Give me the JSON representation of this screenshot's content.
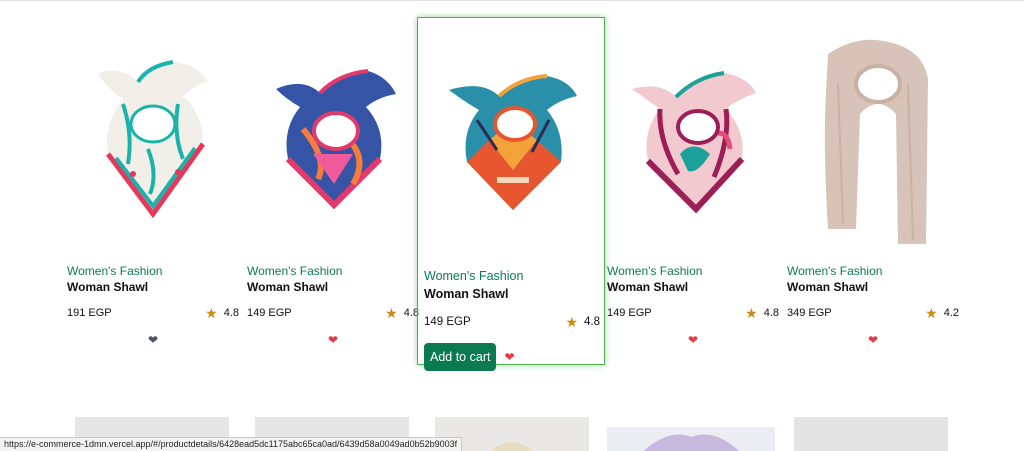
{
  "colors": {
    "accent": "#0a7a51",
    "category_text": "#0d7a52",
    "star": "#d38a0b",
    "heart_active": "#e23b43",
    "heart_inactive": "#4d5561",
    "hover_border": "#4caf50"
  },
  "products": [
    {
      "category": "Women's Fashion",
      "title": "Woman Shawl",
      "price": "191 EGP",
      "rating": "4.8",
      "heart_icon": "heart-icon",
      "heart_color": "dark"
    },
    {
      "category": "Women's Fashion",
      "title": "Woman Shawl",
      "price": "149 EGP",
      "rating": "4.8",
      "heart_icon": "heart-icon",
      "heart_color": "red"
    },
    {
      "category": "Women's Fashion",
      "title": "Woman Shawl",
      "price": "149 EGP",
      "rating": "4.8",
      "heart_icon": "heart-icon",
      "heart_color": "red",
      "add_to_cart_label": "Add to cart"
    },
    {
      "category": "Women's Fashion",
      "title": "Woman Shawl",
      "price": "149 EGP",
      "rating": "4.8",
      "heart_icon": "heart-icon",
      "heart_color": "red"
    },
    {
      "category": "Women's Fashion",
      "title": "Woman Shawl",
      "price": "349 EGP",
      "rating": "4.2",
      "heart_icon": "heart-icon",
      "heart_color": "red"
    }
  ],
  "status_bar": {
    "url": "https://e-commerce-1dmn.vercel.app/#/productdetails/6428ead5dc1175abc65ca0ad/6439d58a0049ad0b52b9003f"
  }
}
